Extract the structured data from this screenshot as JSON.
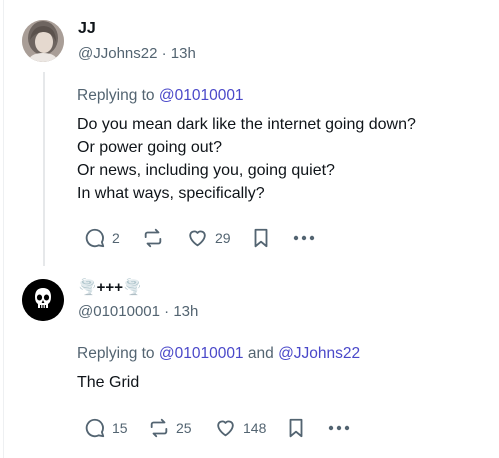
{
  "posts": [
    {
      "name": "JJ",
      "handle": "@JJohns22",
      "time": "13h",
      "replying_prefix": "Replying to",
      "reply_targets": [
        "@01010001"
      ],
      "body_lines": [
        "Do you mean dark like the internet going down?",
        "Or power going out?",
        "Or news, including you, going quiet?",
        "In what ways, specifically?"
      ],
      "stats": {
        "replies": "2",
        "reposts": "",
        "likes": "29"
      }
    },
    {
      "name": "🌪️+++🌪️",
      "handle": "@01010001",
      "time": "13h",
      "replying_prefix": "Replying to",
      "reply_connector": "and",
      "reply_targets": [
        "@01010001",
        "@JJohns22"
      ],
      "body_lines": [
        "The Grid"
      ],
      "stats": {
        "replies": "15",
        "reposts": "25",
        "likes": "148"
      }
    }
  ],
  "separator": "·",
  "icons": [
    "reply-icon",
    "repost-icon",
    "like-icon",
    "bookmark-icon",
    "more-icon",
    "skull-icon"
  ],
  "colors": {
    "text": "#0f1419",
    "muted": "#536471",
    "mention": "#4a48c9"
  }
}
